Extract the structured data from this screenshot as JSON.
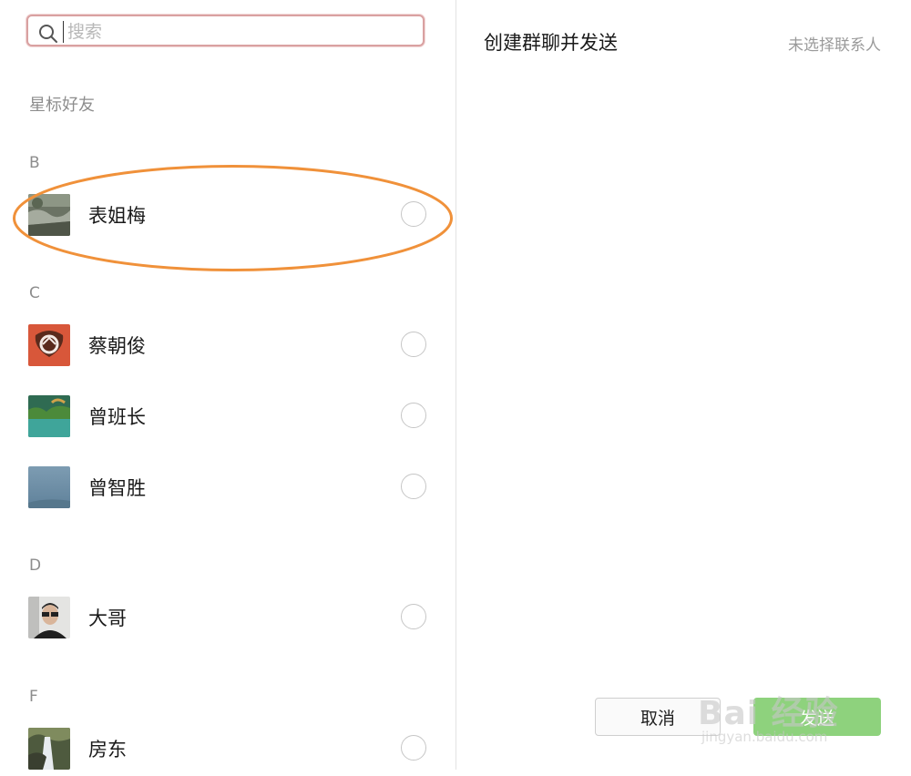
{
  "search": {
    "placeholder": "搜索",
    "value": ""
  },
  "sections": {
    "starred": "星标好友"
  },
  "groups": [
    {
      "letter": "B",
      "contacts": [
        {
          "name": "表姐梅",
          "selected": false,
          "highlighted": true
        }
      ]
    },
    {
      "letter": "C",
      "contacts": [
        {
          "name": "蔡朝俊",
          "selected": false
        },
        {
          "name": "曾班长",
          "selected": false
        },
        {
          "name": "曾智胜",
          "selected": false
        }
      ]
    },
    {
      "letter": "D",
      "contacts": [
        {
          "name": "大哥",
          "selected": false
        }
      ]
    },
    {
      "letter": "F",
      "contacts": [
        {
          "name": "房东",
          "selected": false
        }
      ]
    }
  ],
  "right": {
    "title": "创建群聊并发送",
    "status": "未选择联系人",
    "cancel_label": "取消",
    "confirm_label": "发送"
  },
  "watermark": {
    "brand": "Bai 经验",
    "url": "jingyan.baidu.com"
  },
  "colors": {
    "highlight": "#f0913a",
    "confirm": "#8ed27d",
    "search_border": "#d9a1a1"
  }
}
